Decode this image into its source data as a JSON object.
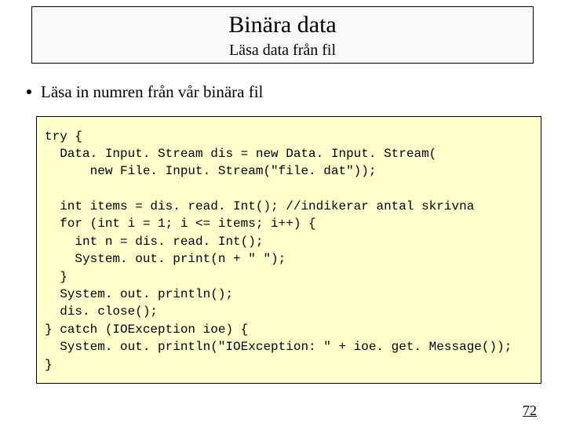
{
  "header": {
    "title": "Binära data",
    "subtitle": "Läsa data från fil"
  },
  "bullet": {
    "text": "Läsa in numren från vår binära fil"
  },
  "code": {
    "content": "try {\n  Data. Input. Stream dis = new Data. Input. Stream(\n      new File. Input. Stream(\"file. dat\"));\n\n  int items = dis. read. Int(); //indikerar antal skrivna\n  for (int i = 1; i <= items; i++) {\n    int n = dis. read. Int();\n    System. out. print(n + \" \");\n  }\n  System. out. println();\n  dis. close();\n} catch (IOException ioe) {\n  System. out. println(\"IOException: \" + ioe. get. Message());\n}"
  },
  "slide": {
    "number": "72"
  }
}
